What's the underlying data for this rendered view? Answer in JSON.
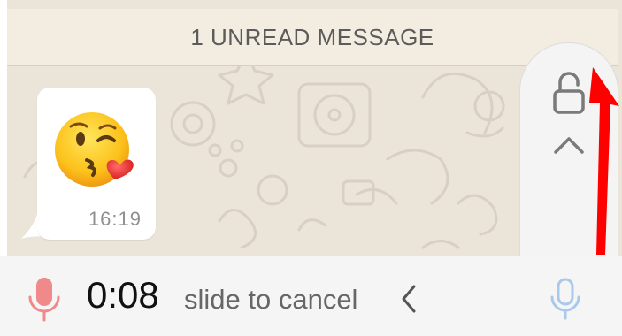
{
  "banner": {
    "text": "1 UNREAD MESSAGE"
  },
  "message": {
    "emoji": "face-blowing-a-kiss",
    "time": "16:19"
  },
  "lock_panel": {
    "icon": "lock-open-icon",
    "chevron": "chevron-up-icon"
  },
  "recording": {
    "timer": "0:08",
    "slide_label": "slide to cancel",
    "cancel_chevron": "chevron-left-icon",
    "left_icon": "mic-icon",
    "right_icon": "mic-icon"
  },
  "colors": {
    "wallpaper": "#ebe4d8",
    "banner": "#f3ece0",
    "bubble": "#ffffff",
    "red_mic": "#f08a8a",
    "blue_mic": "#a9c8ec",
    "annotation_arrow": "#ff0000"
  }
}
